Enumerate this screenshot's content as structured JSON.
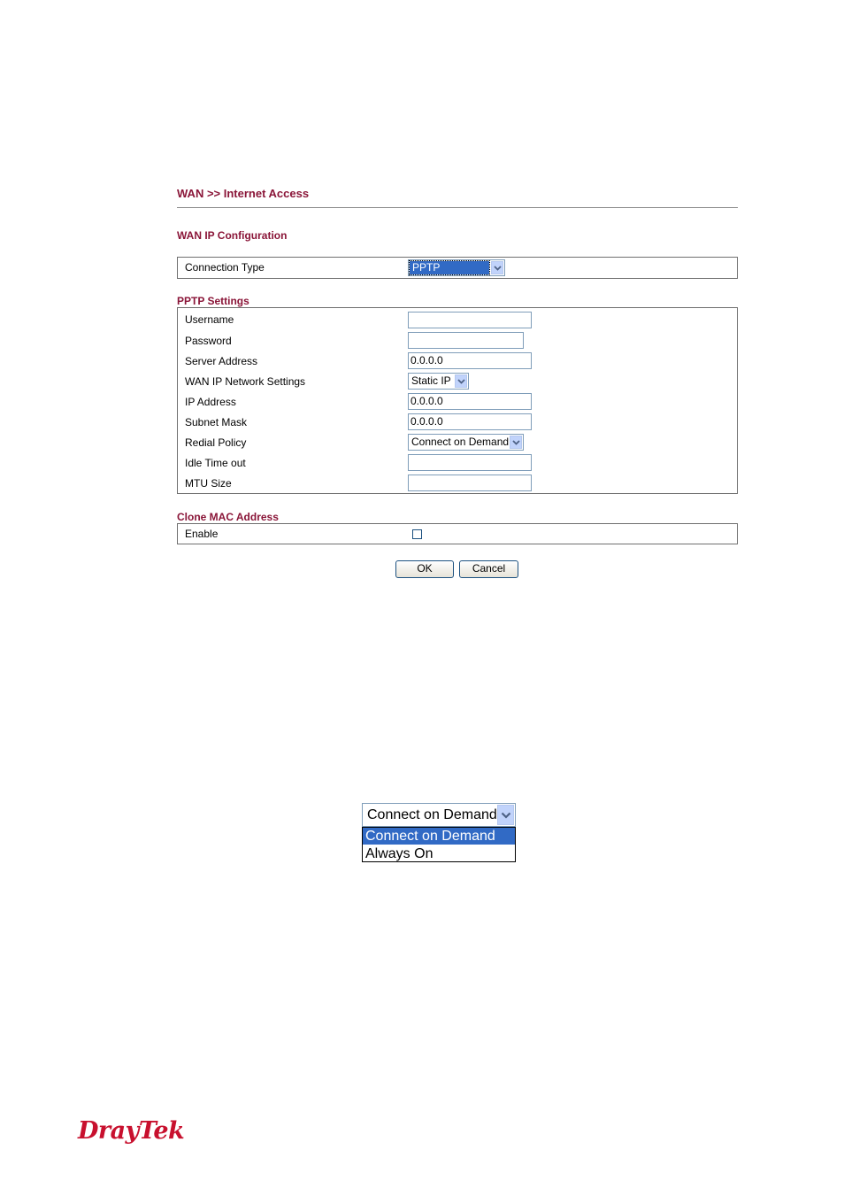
{
  "page": {
    "title": "WAN >> Internet Access",
    "wan_ip_configuration_title": "WAN IP Configuration",
    "connection_type_label": "Connection Type",
    "connection_type_value": "PPTP"
  },
  "pptp": {
    "section_title": "PPTP Settings",
    "username_label": "Username",
    "username_value": "",
    "password_label": "Password",
    "password_value": "",
    "server_address_label": "Server Address",
    "server_address_value": "0.0.0.0",
    "wan_ip_network_settings_label": "WAN IP Network Settings",
    "wan_ip_network_settings_value": "Static IP",
    "ip_address_label": "IP Address",
    "ip_address_value": "0.0.0.0",
    "subnet_mask_label": "Subnet Mask",
    "subnet_mask_value": "0.0.0.0",
    "redial_policy_label": "Redial Policy",
    "redial_policy_value": "Connect on Demand",
    "idle_timeout_label": "Idle Time out",
    "idle_timeout_value": "",
    "mtu_size_label": "MTU Size",
    "mtu_size_value": ""
  },
  "clone_mac": {
    "section_title": "Clone MAC Address",
    "enable_label": "Enable",
    "enable_checked": false
  },
  "buttons": {
    "ok_label": "OK",
    "cancel_label": "Cancel"
  },
  "redial_dropdown_example": {
    "selected_value": "Connect on Demand",
    "options": [
      "Connect on Demand",
      "Always On"
    ],
    "highlighted_option": "Connect on Demand"
  },
  "logo": {
    "text": "DrayTek",
    "color": "#c8102e"
  },
  "colors": {
    "heading": "#8a1538",
    "dropdown_arrow_bg": "#c1d3fb",
    "selected_option_bg": "#316ac5"
  },
  "icons": {
    "dropdown_arrow": "chevron-down-icon"
  }
}
